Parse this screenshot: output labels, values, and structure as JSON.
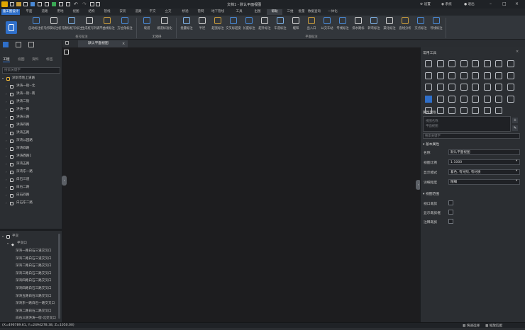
{
  "app": {
    "window_title": "文档1 - 默认平面视图",
    "workbench": "施工图设计"
  },
  "menu_tabs": [
    "平面",
    "道路",
    "用地",
    "视图",
    "结构",
    "管线",
    "安装",
    "道路",
    "平交",
    "立交",
    "桥涵",
    "管网",
    "地下管线",
    "工具",
    "出图",
    "帮助",
    "三维",
    "批量",
    "数据查询",
    "一体化"
  ],
  "active_menu_tab": "标注",
  "titlebar_right": {
    "settings": "设置",
    "system": "系统",
    "user": "退出"
  },
  "ribbon": {
    "groups": [
      {
        "name": "桩号标注",
        "buttons": [
          "自动标注桩号",
          "点取标注桩号",
          "通标桩号标注",
          "生成桩号列表",
          "平曲线标注",
          "方位角标注"
        ]
      },
      {
        "name": "无障碍",
        "buttons": [
          "坡道",
          "坡道标准化"
        ]
      },
      {
        "name": "平面标注",
        "buttons": [
          "批量标注",
          "半径",
          "超宽标注",
          "交叉标超宽",
          "长度标注",
          "超外标注",
          "车道标注",
          "缓和",
          "出入口",
          "公交车站",
          "专线标注",
          "排水路标",
          "转弯标注",
          "渠化标注",
          "直线分析",
          "交点标注",
          "导线标注"
        ]
      }
    ]
  },
  "left_panel": {
    "tabs": [
      "工程",
      "视图",
      "资料",
      "标签"
    ],
    "search_placeholder": "搜索关键字",
    "tree_root": "深圳市地上道路",
    "tree_items": [
      "洪涛一街--北",
      "洪涛一街--南",
      "洪涛二街",
      "洪涛一路",
      "洪涛三路",
      "洪涛四路",
      "洪涛五路",
      "深湾公园路",
      "深湾四路",
      "洪涛西路1",
      "深湾五路",
      "深湾东一路",
      "白石三道",
      "白石二路",
      "白石四路",
      "白石东二路"
    ],
    "bottom_root": "平交",
    "bottom_sub": "平交口",
    "bottom_items": [
      "深湾一路白石三道交叉口",
      "深湾二路白石三道交叉口",
      "深湾二路白石二路交叉口",
      "深湾三路白石二路交叉口",
      "深湾四路白石二路交叉口",
      "深湾四路白石三路交叉口",
      "深湾五路白石三路交叉口",
      "深湾东一路白石一路交叉口",
      "深湾二路白石二路交叉口",
      "白石三道洪涛一街-北交叉口",
      "白石三道深湾二路交叉口"
    ]
  },
  "doc_tab": "默认平面视图",
  "right_panel": {
    "tools_title": "常用工具",
    "props_title": "属性面板",
    "props_preview": [
      "视图名称",
      "平面视图"
    ],
    "props_search_placeholder": "搜索关键字",
    "section_basic": "基本属性",
    "rows": [
      {
        "label": "名称",
        "value": "默认平面视图"
      },
      {
        "label": "视图比例",
        "value": "1:1000"
      },
      {
        "label": "显示模式",
        "value": "着色, 有光照, 有材质"
      },
      {
        "label": "详细程度",
        "value": "精细"
      }
    ],
    "section_range": "视图范围",
    "check_rows": [
      "视口裁剪",
      "显示裁剪框",
      "注释裁剪"
    ]
  },
  "status": {
    "coords": "(X=496789.61, Y=2494278.38, Z=1050.00)",
    "right_items": [
      "快速选择",
      "捕捉",
      "缩放匹配"
    ]
  },
  "colors": {
    "accent": "#2f6fc9",
    "canvas": "#1d1d1f",
    "panel": "#2b2e32"
  }
}
